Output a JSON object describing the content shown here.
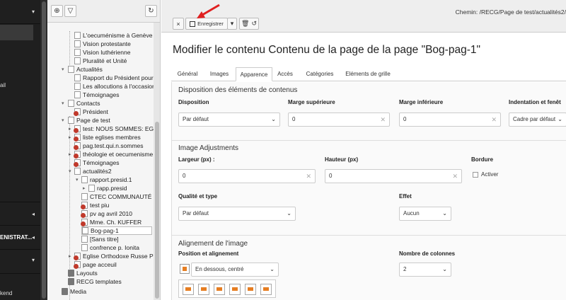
{
  "modmenu": {
    "label_ail": "ail",
    "label_admin": "ENISTRAT...",
    "label_backend": "kend"
  },
  "tree": {
    "items": [
      {
        "label": "L'oecuménisme à  Genève ;"
      },
      {
        "label": "Vision protestante"
      },
      {
        "label": "Vision luthérienne"
      },
      {
        "label": "Pluralité et Unité"
      },
      {
        "label": "Actualités"
      },
      {
        "label": "Rapport du Président pour l"
      },
      {
        "label": "Les allocutions à  l'occasion"
      },
      {
        "label": "Témoignages"
      },
      {
        "label": "Contacts"
      },
      {
        "label": "Président"
      },
      {
        "label": "Page de test"
      },
      {
        "label": "test: NOUS SOMMES: EGLI"
      },
      {
        "label": "liste eglises membres"
      },
      {
        "label": "pag.test.qui.n.sommes"
      },
      {
        "label": "théologie et oecumenisme"
      },
      {
        "label": "Témoignages"
      },
      {
        "label": "actualités2"
      },
      {
        "label": "rapport.presid.1"
      },
      {
        "label": "rapp.presid"
      },
      {
        "label": "CTEC COMMUNAUTÉ DE"
      },
      {
        "label": "test piu"
      },
      {
        "label": "pv ag avril 2010"
      },
      {
        "label": "Mme. Ch. KUFFER"
      },
      {
        "label": "Bog-pag-1"
      },
      {
        "label": "[Sans titre]"
      },
      {
        "label": "confrence p. Ionita"
      },
      {
        "label": "Eglise Orthodoxe Russe Pat"
      },
      {
        "label": "page acceuil"
      },
      {
        "label": "Layouts"
      },
      {
        "label": "RECG templates"
      },
      {
        "label": "Media"
      }
    ]
  },
  "header": {
    "breadcrumb": "Chemin: /RECG/Page de test/actualités2/",
    "save_label": "Enregistrer",
    "close_glyph": "×",
    "dropdown_glyph": "▾",
    "delete_glyph": "🗑",
    "undo_glyph": "↺"
  },
  "title": "Modifier le contenu Contenu de la page de la page \"Bog-pag-1\"",
  "tabs": [
    {
      "label": "Général"
    },
    {
      "label": "Images"
    },
    {
      "label": "Apparence"
    },
    {
      "label": "Accès"
    },
    {
      "label": "Catégories"
    },
    {
      "label": "Eléments de grille"
    }
  ],
  "panels": {
    "disposition": {
      "title": "Disposition des éléments de contenus",
      "layout_label": "Disposition",
      "layout_value": "Par défaut",
      "space_before_label": "Marge supérieure",
      "space_before_value": "0",
      "space_after_label": "Marge inférieure",
      "space_after_value": "0",
      "indent_label": "Indentation et fenêt",
      "indent_value": "Cadre par défaut"
    },
    "image_adjust": {
      "title": "Image Adjustments",
      "width_label": "Largeur (px) :",
      "width_value": "0",
      "height_label": "Hauteur (px)",
      "height_value": "0",
      "border_label": "Bordure",
      "border_check_label": "Activer",
      "quality_label": "Qualité et type",
      "quality_value": "Par défaut",
      "effect_label": "Effet",
      "effect_value": "Aucun"
    },
    "alignment": {
      "title": "Alignement de l'image",
      "position_label": "Position et alignement",
      "position_value": "En dessous, centré",
      "columns_label": "Nombre de colonnes",
      "columns_value": "2"
    }
  }
}
